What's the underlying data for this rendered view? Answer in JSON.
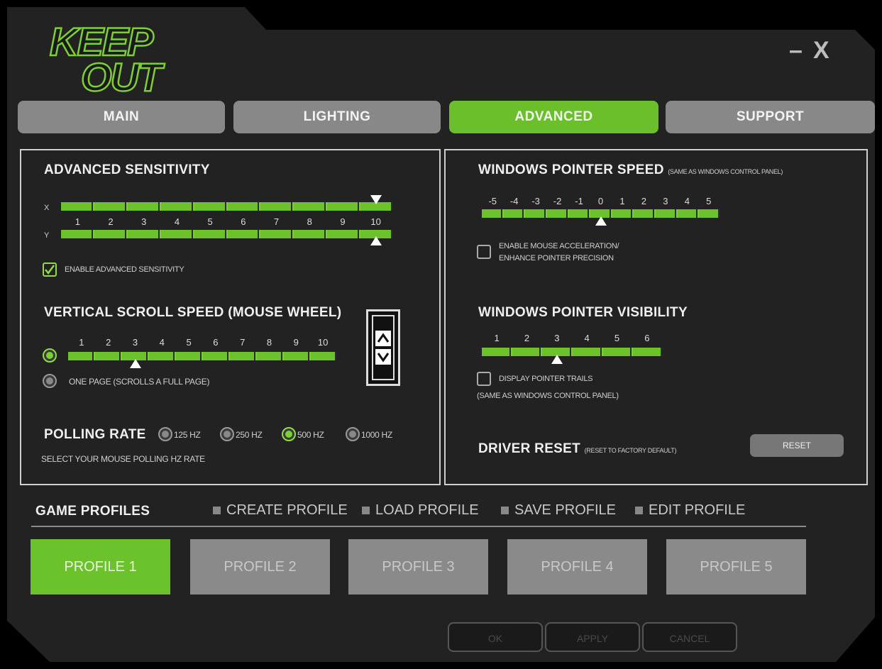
{
  "app": {
    "logo_text": [
      "KEEP",
      "OUT"
    ],
    "window_controls": {
      "minimize": "–",
      "close": "X"
    }
  },
  "tabs": [
    {
      "label": "MAIN",
      "active": false
    },
    {
      "label": "LIGHTING",
      "active": false
    },
    {
      "label": "ADVANCED",
      "active": true
    },
    {
      "label": "SUPPORT",
      "active": false
    }
  ],
  "left": {
    "advanced_sensitivity": {
      "title": "ADVANCED SENSITIVITY",
      "x_label": "X",
      "y_label": "Y",
      "ticks": [
        "1",
        "2",
        "3",
        "4",
        "5",
        "6",
        "7",
        "8",
        "9",
        "10"
      ],
      "x_value": 10,
      "y_value": 10,
      "checkbox_label": "ENABLE ADVANCED SENSITIVITY",
      "checked": true
    },
    "scroll_speed": {
      "title": "VERTICAL SCROLL SPEED (MOUSE WHEEL)",
      "ticks": [
        "1",
        "2",
        "3",
        "4",
        "5",
        "6",
        "7",
        "8",
        "9",
        "10"
      ],
      "value": 3,
      "one_page_label": "ONE PAGE (SCROLLS A FULL PAGE)"
    },
    "polling": {
      "title": "POLLING RATE",
      "options": [
        "125 HZ",
        "250 HZ",
        "500 HZ",
        "1000 HZ"
      ],
      "selected": "500 HZ",
      "hint": "SELECT YOUR MOUSE POLLING HZ RATE"
    }
  },
  "right": {
    "pointer_speed": {
      "title": "WINDOWS POINTER SPEED",
      "subtitle": "(SAME AS WINDOWS CONTROL PANEL)",
      "ticks": [
        "-5",
        "-4",
        "-3",
        "-2",
        "-1",
        "0",
        "1",
        "2",
        "3",
        "4",
        "5"
      ],
      "value": 0,
      "checkbox_line1": "ENABLE MOUSE ACCELERATION/",
      "checkbox_line2": "ENHANCE POINTER PRECISION",
      "checked": false
    },
    "pointer_visibility": {
      "title": "WINDOWS POINTER VISIBILITY",
      "ticks": [
        "1",
        "2",
        "3",
        "4",
        "5",
        "6"
      ],
      "value": 3,
      "checkbox_label": "DISPLAY POINTER TRAILS",
      "note": "(SAME AS WINDOWS CONTROL PANEL)",
      "checked": false
    },
    "driver_reset": {
      "title": "DRIVER RESET",
      "subtitle": "(RESET TO FACTORY DEFAULT)",
      "button": "RESET"
    }
  },
  "game_profiles": {
    "title": "GAME PROFILES",
    "actions": [
      "CREATE PROFILE",
      "LOAD PROFILE",
      "SAVE PROFILE",
      "EDIT PROFILE"
    ],
    "profiles": [
      "PROFILE 1",
      "PROFILE 2",
      "PROFILE 3",
      "PROFILE 4",
      "PROFILE 5"
    ],
    "active": "PROFILE 1"
  },
  "footer": {
    "ok": "OK",
    "apply": "APPLY",
    "cancel": "CANCEL"
  },
  "colors": {
    "accent": "#6cc22a",
    "tab_inactive": "#888888",
    "background": "#222222"
  }
}
